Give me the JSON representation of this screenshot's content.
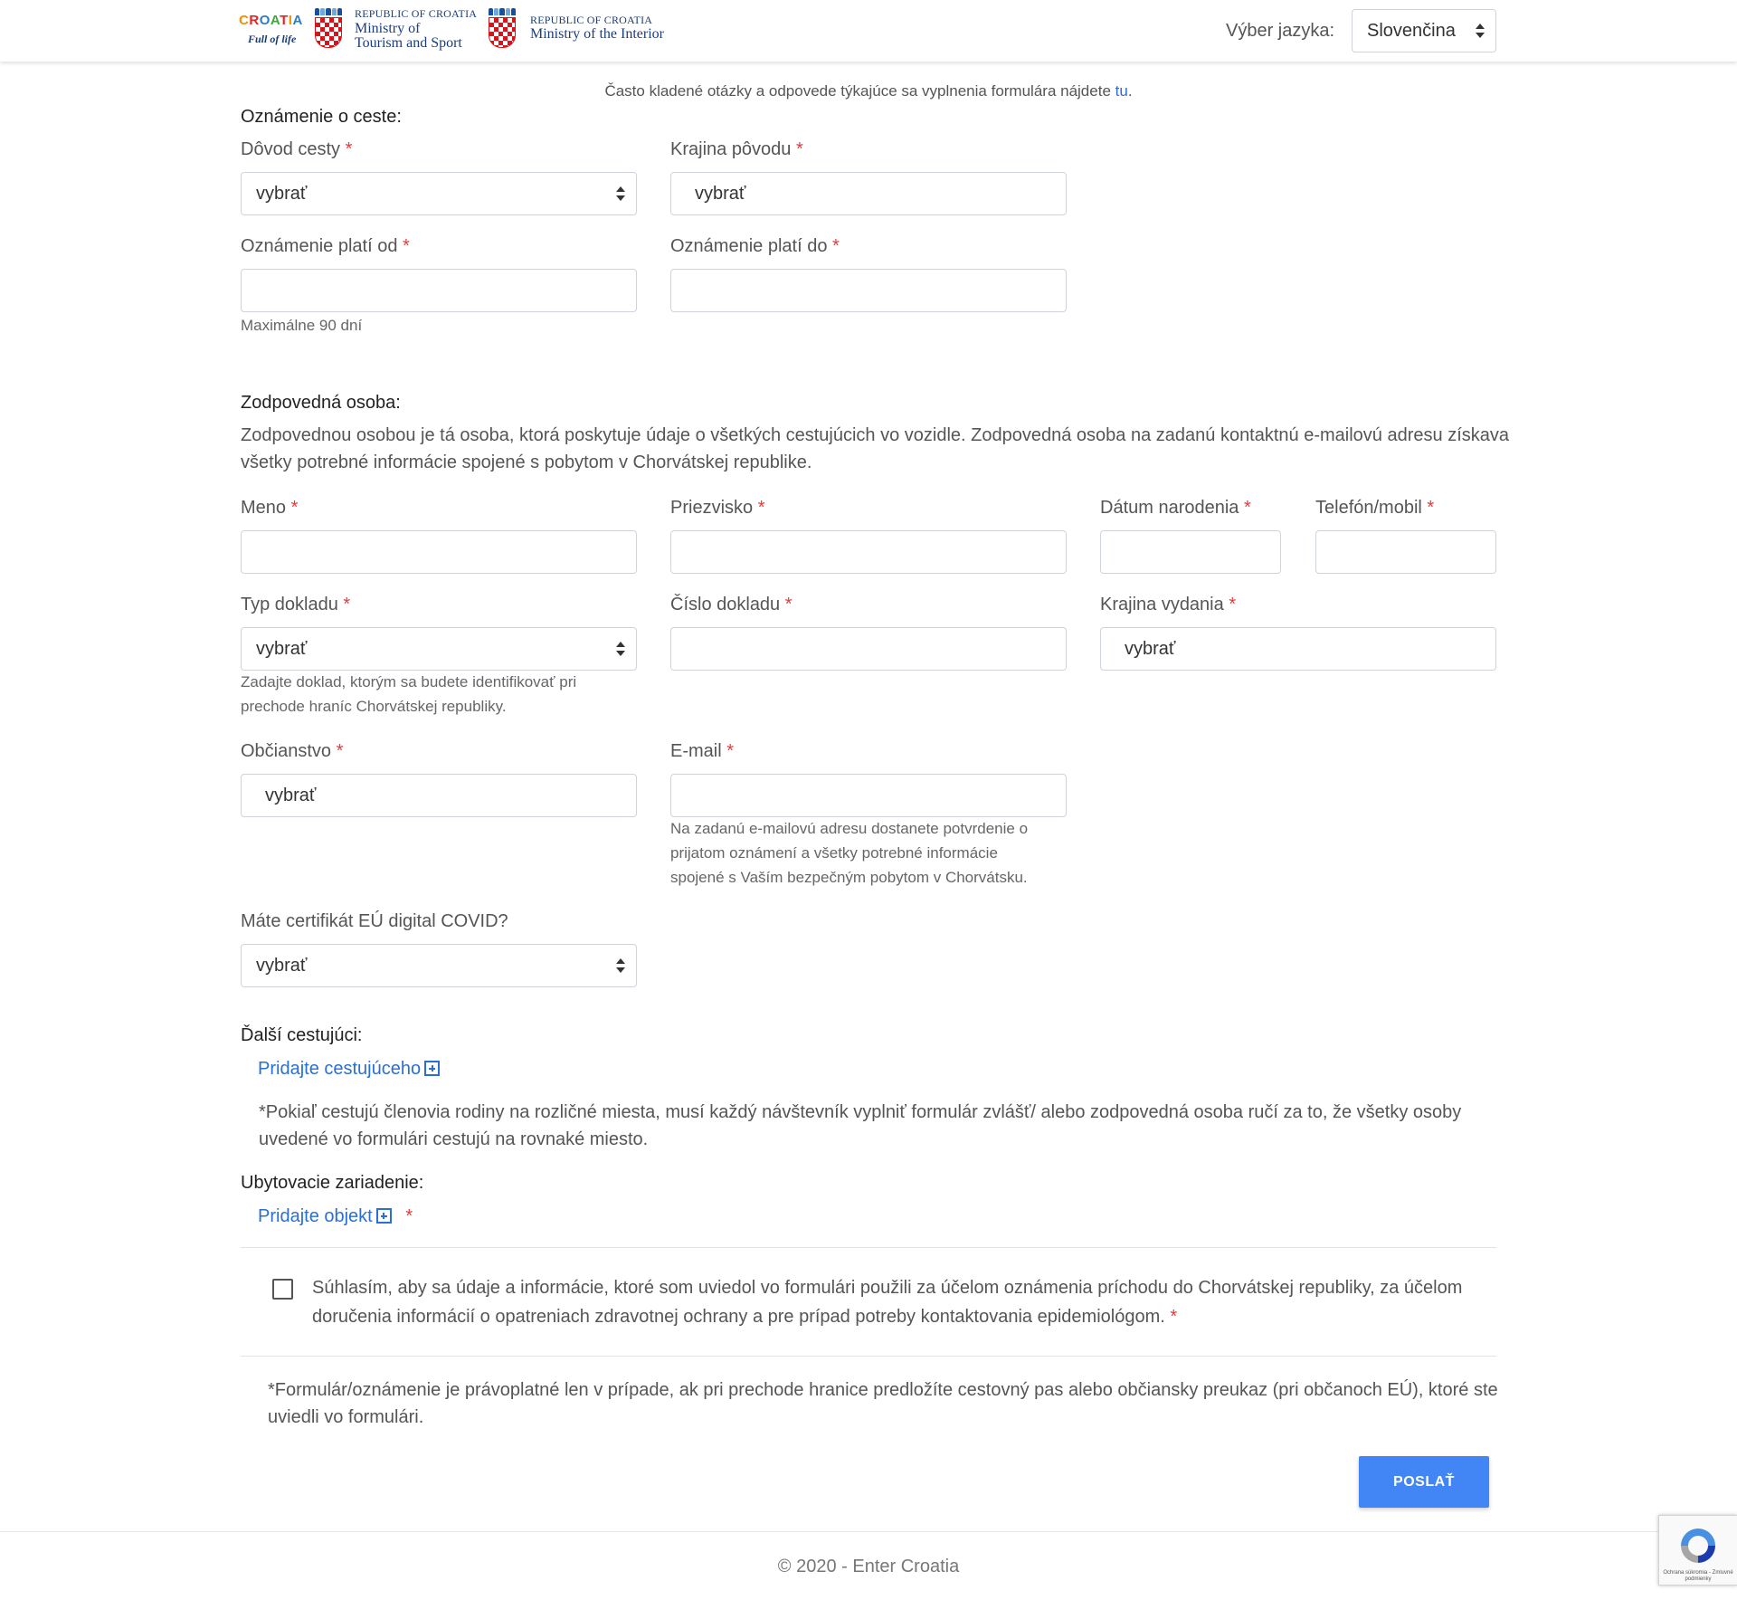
{
  "header": {
    "croatia_logo": {
      "word": "CROATIA",
      "tagline": "Full of life"
    },
    "ministry_tourism": {
      "line1": "REPUBLIC OF CROATIA",
      "line2": "Ministry of",
      "line3": "Tourism and Sport"
    },
    "ministry_interior": {
      "line1": "REPUBLIC OF CROATIA",
      "line2": "Ministry of the Interior"
    },
    "language_label": "Výber jazyka:",
    "language_value": "Slovenčina"
  },
  "faq": {
    "text": "Často kladené otázky a odpovede týkajúce sa vyplnenia formulára nájdete ",
    "link": "tu",
    "end": "."
  },
  "trip": {
    "title": "Oznámenie o ceste:",
    "reason_label": "Dôvod cesty",
    "reason_value": "vybrať",
    "origin_label": "Krajina pôvodu",
    "origin_value": "vybrať",
    "valid_from_label": "Oznámenie platí od",
    "valid_from_value": "",
    "valid_to_label": "Oznámenie platí do",
    "valid_to_value": "",
    "max_days_hint": "Maximálne 90 dní"
  },
  "person": {
    "title": "Zodpovedná osoba:",
    "description_line1": "Zodpovednou osobou je tá osoba, ktorá poskytuje údaje o všetkých cestujúcich vo vozidle. Zodpovedná osoba na zadanú kontaktnú e-mailovú adresu získava",
    "description_line2": "všetky potrebné informácie spojené s pobytom v Chorvátskej republike.",
    "name_label": "Meno",
    "surname_label": "Priezvisko",
    "birthdate_label": "Dátum narodenia",
    "phone_label": "Telefón/mobil",
    "doc_type_label": "Typ dokladu",
    "doc_type_value": "vybrať",
    "doc_type_hint_line1": "Zadajte doklad, ktorým sa budete identifikovať pri",
    "doc_type_hint_line2": "prechode hraníc Chorvátskej republiky.",
    "doc_number_label": "Číslo dokladu",
    "issue_country_label": "Krajina vydania",
    "issue_country_value": "vybrať",
    "citizenship_label": "Občianstvo",
    "citizenship_value": "vybrať",
    "email_label": "E-mail",
    "email_hint_line1": "Na zadanú e-mailovú adresu dostanete potvrdenie o",
    "email_hint_line2": "prijatom oznámení a všetky potrebné informácie",
    "email_hint_line3": "spojené s Vaším bezpečným pobytom v Chorvátsku.",
    "covid_label": "Máte certifikát EÚ digital COVID?",
    "covid_value": "vybrať"
  },
  "travellers": {
    "title": "Ďalší cestujúci:",
    "add_link": "Pridajte cestujúceho",
    "note_line1": "*Pokiaľ cestujú členovia rodiny na rozličné miesta, musí každý návštevník vyplniť formulár zvlášť/ alebo zodpovedná osoba ručí za to, že všetky osoby",
    "note_line2": "uvedené vo formulári cestujú na rovnaké miesto."
  },
  "accommodation": {
    "title": "Ubytovacie zariadenie:",
    "add_link": "Pridajte objekt"
  },
  "consent": {
    "line1": "Súhlasím, aby sa údaje a informácie, ktoré som uviedol vo formulári použili za účelom oznámenia príchodu do Chorvátskej republiky, za účelom",
    "line2": "doručenia informácií o opatreniach zdravotnej ochrany a pre prípad potreby kontaktovania epidemiológom."
  },
  "validity_note": {
    "line1": "*Formulár/oznámenie je právoplatné len v prípade, ak pri prechode hranice predložíte cestovný pas alebo občiansky preukaz (pri občanoch EÚ), ktoré ste",
    "line2": "uviedli vo formulári."
  },
  "required_mark": "*",
  "submit_label": "POSLAŤ",
  "footer": {
    "text": "© 2020 - Enter Croatia"
  },
  "recaptcha": {
    "caption": "Ochrana súkromia - Zmluvné podmienky"
  },
  "colors": {
    "accent": "#4285f4",
    "link": "#2a6fd6",
    "required": "#e23c3c"
  }
}
